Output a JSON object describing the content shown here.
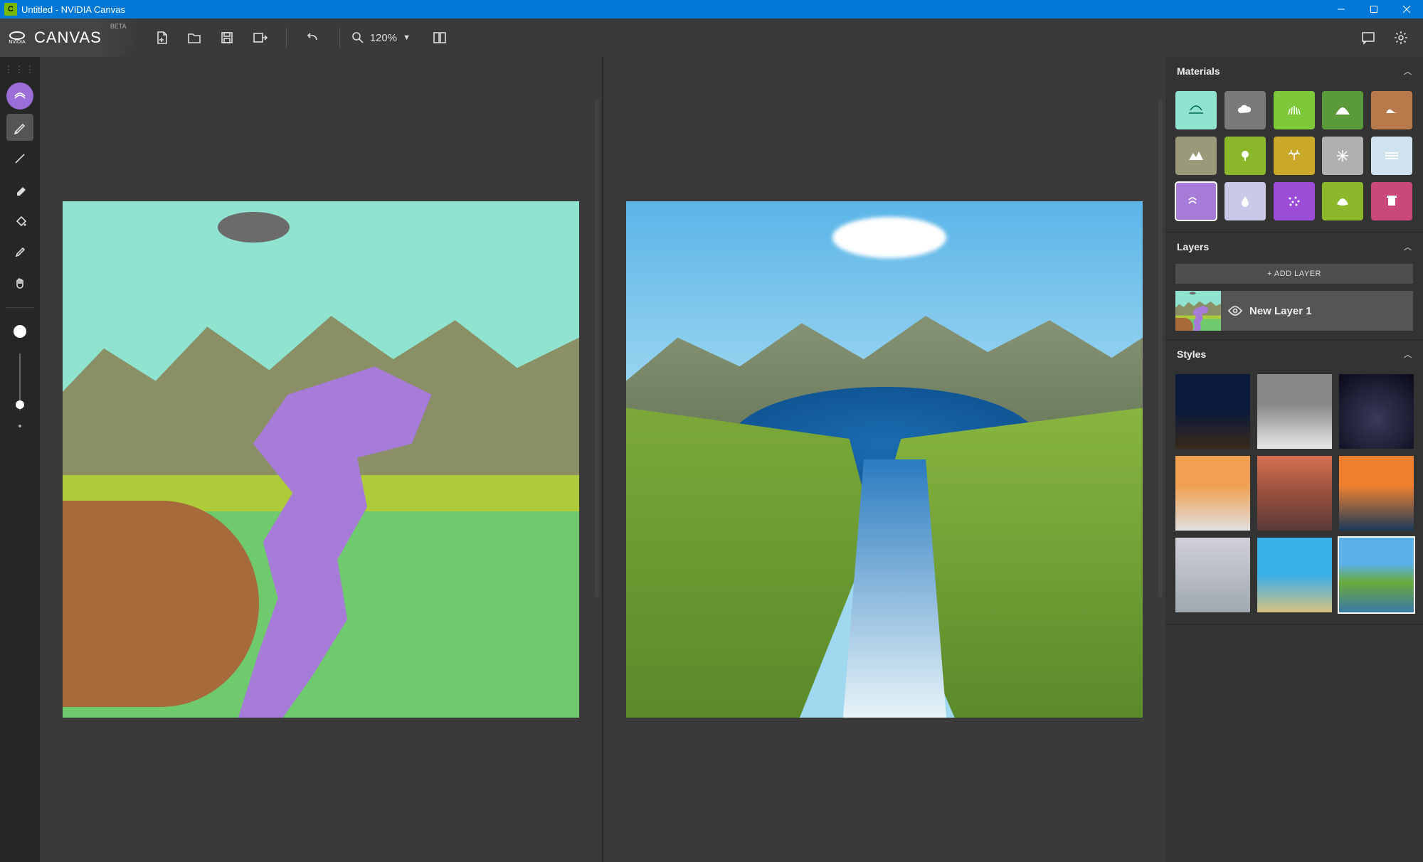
{
  "window": {
    "title": "Untitled - NVIDIA Canvas"
  },
  "brand": {
    "name": "CANVAS",
    "tag": "BETA",
    "logo_text": "NVIDIA"
  },
  "toolbar": {
    "zoom_value": "120%"
  },
  "panels": {
    "materials": {
      "title": "Materials",
      "items": [
        {
          "name": "sky",
          "color": "#8fe3cf",
          "icon": "sky",
          "selected": false
        },
        {
          "name": "cloud",
          "color": "#7a7a7a",
          "icon": "cloud",
          "selected": false
        },
        {
          "name": "grass",
          "color": "#7ec93a",
          "icon": "grass",
          "selected": false
        },
        {
          "name": "hill",
          "color": "#5a9a3a",
          "icon": "hill",
          "selected": false
        },
        {
          "name": "dirt",
          "color": "#b87a4a",
          "icon": "dirt",
          "selected": false
        },
        {
          "name": "mountain",
          "color": "#9a9a7a",
          "icon": "mountain",
          "selected": false
        },
        {
          "name": "tree",
          "color": "#8ab82a",
          "icon": "tree",
          "selected": false
        },
        {
          "name": "bush",
          "color": "#c9a82a",
          "icon": "palm",
          "selected": false
        },
        {
          "name": "snow",
          "color": "#b0b0b0",
          "icon": "snow",
          "selected": false
        },
        {
          "name": "fog",
          "color": "#cfe3ef",
          "icon": "fog",
          "selected": false
        },
        {
          "name": "sea",
          "color": "#a77bd8",
          "icon": "water",
          "selected": true
        },
        {
          "name": "river",
          "color": "#c9c9e8",
          "icon": "drop",
          "selected": false
        },
        {
          "name": "gravel",
          "color": "#9b4dd7",
          "icon": "dots",
          "selected": false
        },
        {
          "name": "stone",
          "color": "#8ab82a",
          "icon": "stone",
          "selected": false
        },
        {
          "name": "building",
          "color": "#c94a7a",
          "icon": "building",
          "selected": false
        }
      ]
    },
    "layers": {
      "title": "Layers",
      "add_label": "+ ADD LAYER",
      "items": [
        {
          "name": "New Layer 1",
          "visible": true
        }
      ]
    },
    "styles": {
      "title": "Styles",
      "items": [
        {
          "name": "night-desert",
          "selected": false
        },
        {
          "name": "cloudy-peak",
          "selected": false
        },
        {
          "name": "arch-stars",
          "selected": false
        },
        {
          "name": "sunset-clouds",
          "selected": false
        },
        {
          "name": "red-mountain",
          "selected": false
        },
        {
          "name": "ocean-sunset",
          "selected": false
        },
        {
          "name": "snow-valley",
          "selected": false
        },
        {
          "name": "beach-day",
          "selected": false
        },
        {
          "name": "lake-meadow",
          "selected": true
        }
      ]
    }
  }
}
